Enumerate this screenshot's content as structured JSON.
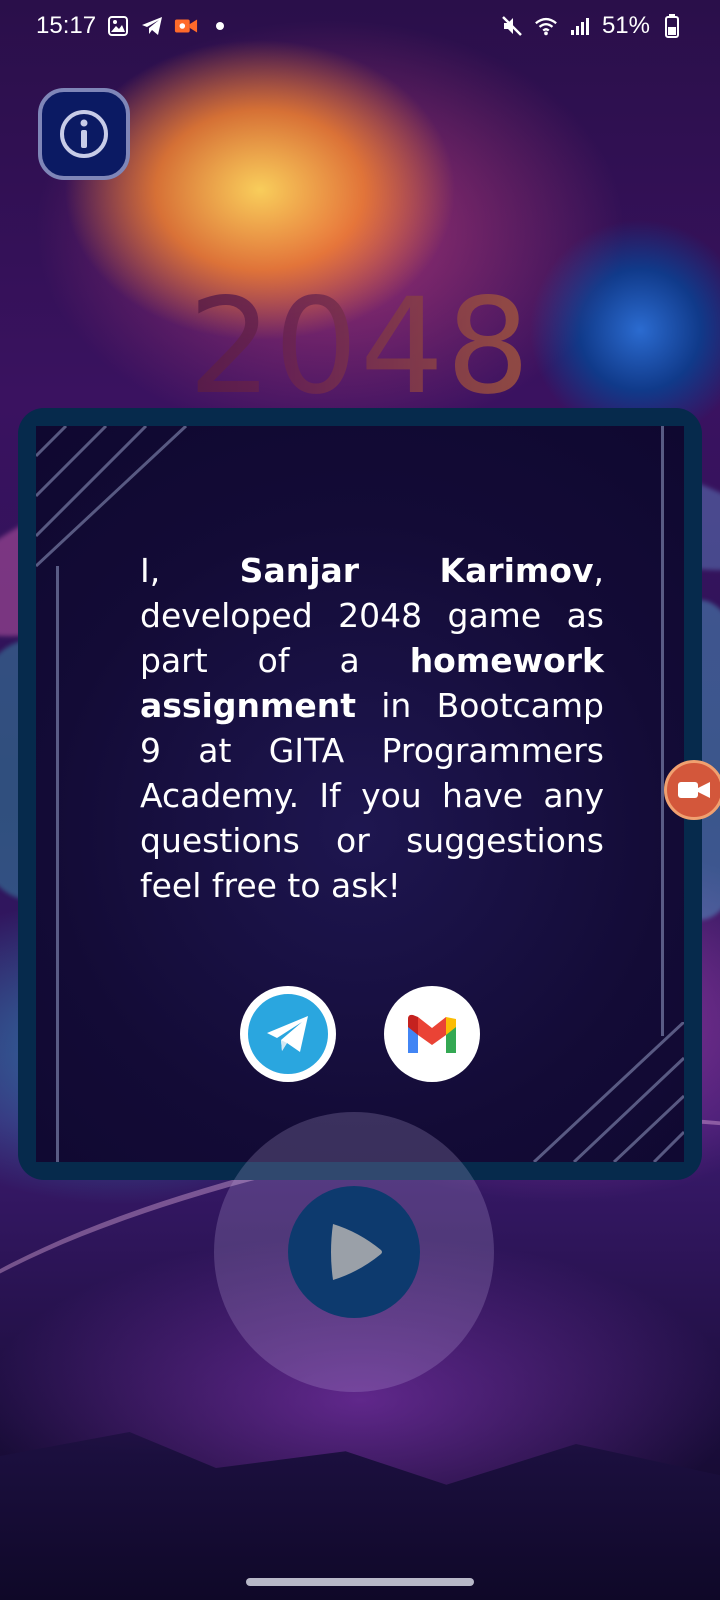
{
  "status_bar": {
    "time": "15:17",
    "battery": "51%",
    "left_icons": [
      "gallery-icon",
      "telegram-icon",
      "screen-record-icon",
      "dot-icon"
    ],
    "right_icons": [
      "mute-icon",
      "wifi-icon",
      "signal-icon",
      "battery-icon"
    ]
  },
  "game": {
    "title": "2048"
  },
  "about": {
    "text_segments": [
      {
        "text": "I, ",
        "bold": false
      },
      {
        "text": "Sanjar Karimov",
        "bold": true
      },
      {
        "text": ", developed 2048 game as part of a ",
        "bold": false
      },
      {
        "text": "homework assignment",
        "bold": true
      },
      {
        "text": " in Bootcamp 9 at GITA Programmers Academy. If you have any questions or suggestions feel free to ask!",
        "bold": false
      }
    ],
    "contacts": [
      {
        "name": "telegram",
        "icon": "telegram-icon",
        "color": "#2aa6df"
      },
      {
        "name": "gmail",
        "icon": "gmail-icon",
        "color": "#ffffff"
      }
    ]
  },
  "colors": {
    "card_frame": "#062a4c",
    "card_bg": "#130b36",
    "info_button": "#0b1a63",
    "play_button": "#0d3a6e"
  }
}
